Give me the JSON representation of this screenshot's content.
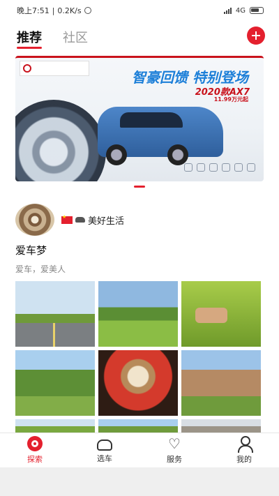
{
  "status_bar": {
    "time": "晚上7:51",
    "speed": "0.2K/s",
    "network": "4G"
  },
  "header": {
    "tabs": [
      {
        "label": "推荐",
        "active": true
      },
      {
        "label": "社区",
        "active": false
      }
    ],
    "add_icon": "plus-icon",
    "accent_color": "#e4202e"
  },
  "banner": {
    "title": "智豪回馈 特别登场",
    "model": "2020款AX7",
    "price": "11.99万元起",
    "slide_count": 1,
    "active_slide": 1
  },
  "post": {
    "username": "美好生活",
    "title": "爱车梦",
    "text": "爱车，爱美人",
    "photos": [
      {
        "icon": "road-photo"
      },
      {
        "icon": "grassland-photo"
      },
      {
        "icon": "cow-photo"
      },
      {
        "icon": "meadow-photo"
      },
      {
        "icon": "coffee-photo"
      },
      {
        "icon": "rock-photo"
      }
    ]
  },
  "bottom_nav": {
    "items": [
      {
        "label": "探索",
        "icon": "explore-icon",
        "active": true
      },
      {
        "label": "选车",
        "icon": "car-icon",
        "active": false
      },
      {
        "label": "服务",
        "icon": "heart-icon",
        "active": false
      },
      {
        "label": "我的",
        "icon": "user-icon",
        "active": false
      }
    ]
  }
}
